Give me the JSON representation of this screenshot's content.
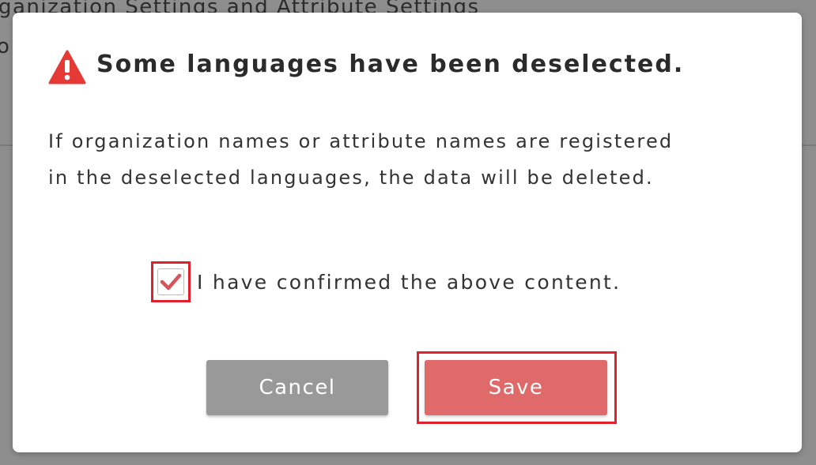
{
  "background": {
    "heading_fragment": "ganization Settings and Attribute Settings",
    "text_fragment": "o"
  },
  "dialog": {
    "icon": "warning-triangle-icon",
    "title": "Some languages have been deselected.",
    "message_lines": [
      "If organization names or attribute names are registered",
      "in the deselected languages, the data will be deleted."
    ],
    "confirm_checkbox": {
      "label": "I have confirmed the above content.",
      "checked": true
    },
    "buttons": {
      "cancel": "Cancel",
      "save": "Save"
    }
  },
  "colors": {
    "warning": "#e53935",
    "save_button": "#e06a6a",
    "cancel_button": "#999999",
    "highlight": "#e0202a",
    "checkmark": "#d9535a"
  }
}
